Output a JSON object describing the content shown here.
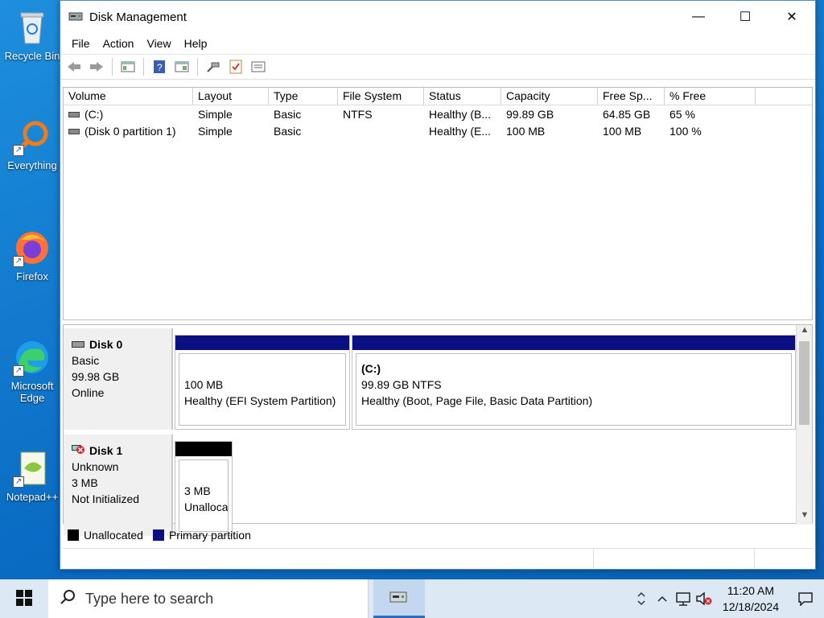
{
  "desktop": {
    "icons": [
      {
        "label": "Recycle Bin",
        "icon": "recycle-bin-icon"
      },
      {
        "label": "Everything",
        "icon": "everything-search-icon"
      },
      {
        "label": "Firefox",
        "icon": "firefox-icon"
      },
      {
        "label": "Microsoft Edge",
        "icon": "edge-icon"
      },
      {
        "label": "Notepad++",
        "icon": "notepad-plus-plus-icon"
      }
    ]
  },
  "window": {
    "title": "Disk Management",
    "minimize_glyph": "—",
    "maximize_glyph": "☐",
    "close_glyph": "✕"
  },
  "menu": [
    "File",
    "Action",
    "View",
    "Help"
  ],
  "toolbar": {
    "buttons": [
      "back-icon",
      "forward-icon",
      "show-hide-console-tree-icon",
      "help-icon",
      "properties-icon",
      "connect-icon",
      "checklist-icon",
      "settings-icon"
    ]
  },
  "volume_list": {
    "columns": [
      "Volume",
      "Layout",
      "Type",
      "File System",
      "Status",
      "Capacity",
      "Free Sp...",
      "% Free"
    ],
    "rows": [
      [
        "(C:)",
        "Simple",
        "Basic",
        "NTFS",
        "Healthy (B...",
        "99.89 GB",
        "64.85 GB",
        "65 %"
      ],
      [
        "(Disk 0 partition 1)",
        "Simple",
        "Basic",
        "",
        "Healthy (E...",
        "100 MB",
        "100 MB",
        "100 %"
      ]
    ]
  },
  "disks": [
    {
      "name": "Disk 0",
      "type": "Basic",
      "size": "99.98 GB",
      "state": "Online",
      "partitions": [
        {
          "title": "",
          "size": "100 MB",
          "status": "Healthy (EFI System Partition)",
          "kind": "primary"
        },
        {
          "title": "(C:)",
          "size": "99.89 GB NTFS",
          "status": "Healthy (Boot, Page File, Basic Data Partition)",
          "kind": "primary"
        }
      ]
    },
    {
      "name": "Disk 1",
      "type": "Unknown",
      "size": "3 MB",
      "state": "Not Initialized",
      "partitions": [
        {
          "title": "",
          "size": "3 MB",
          "status": "Unalloca",
          "kind": "unallocated"
        }
      ]
    }
  ],
  "legend": {
    "unallocated": "Unallocated",
    "primary": "Primary partition"
  },
  "colors": {
    "primary_bar": "#0a0f82",
    "unallocated_bar": "#000000",
    "taskbar_bg": "#dce8f4"
  },
  "taskbar": {
    "search_placeholder": "Type here to search",
    "time": "11:20 AM",
    "date": "12/18/2024"
  }
}
